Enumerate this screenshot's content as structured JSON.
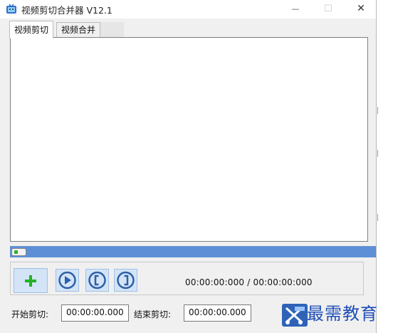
{
  "window": {
    "title": "视频剪切合并器 V12.1",
    "minimize_glyph": "—",
    "maximize_glyph": "☐",
    "close_glyph": "✕"
  },
  "tabs": [
    {
      "label": "视频剪切",
      "active": true
    },
    {
      "label": "视频合并",
      "active": false
    }
  ],
  "player": {
    "progress_fraction": 1.0,
    "time_readout": "00:00:00:000 / 00:00:00:000"
  },
  "toolbar": {
    "add_icon": "plus-icon",
    "play_icon": "play-icon",
    "mark_in_icon": "bracket-left-icon",
    "mark_out_icon": "bracket-right-icon"
  },
  "cut": {
    "start_label": "开始剪切:",
    "start_value": "00:00:00.000",
    "end_label": "结束剪切:",
    "end_value": "00:00:00.000"
  },
  "watermark": {
    "text": "最需教育"
  },
  "colors": {
    "accent": "#7aa4db",
    "button_bg": "#d4e4f7",
    "add_green": "#23b223",
    "watermark_blue": "#1f4fb8"
  }
}
